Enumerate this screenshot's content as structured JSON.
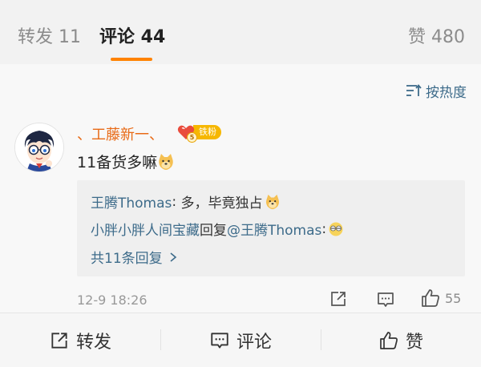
{
  "tabs": {
    "repost": "转发 11",
    "comment": "评论 44",
    "like": "赞 480"
  },
  "sort_label": "按热度",
  "comment": {
    "username": "、工藤新一、",
    "fan_level": "5",
    "fan_badge_label": "铁粉",
    "text": "11备货多嘛",
    "time": "12-9 18:26",
    "like_count": "55"
  },
  "replies": [
    {
      "author": "王腾Thomas",
      "separator": ": ",
      "text": "多，毕竟独占"
    },
    {
      "author": "小胖小胖人间宝藏",
      "action": "回复",
      "mention": "@王腾Thomas",
      "colon": ":"
    }
  ],
  "more_replies": "共11条回复",
  "bottom_bar": {
    "repost": "转发",
    "comment": "评论",
    "like": "赞"
  },
  "colors": {
    "accent": "#ff8200",
    "username": "#e86a16",
    "link": "#3d6b8a",
    "fan_badge": "#f6b700"
  },
  "icons": {
    "sort": "sort-icon",
    "avatar": "anime-character-avatar",
    "fan_badge": "heart-badge-icon",
    "emoji_doge": "doge-emoji",
    "emoji_eyes": "squinting-eyes-emoji",
    "share": "share-icon",
    "reply": "comment-bubble-icon",
    "like": "thumbs-up-icon"
  }
}
